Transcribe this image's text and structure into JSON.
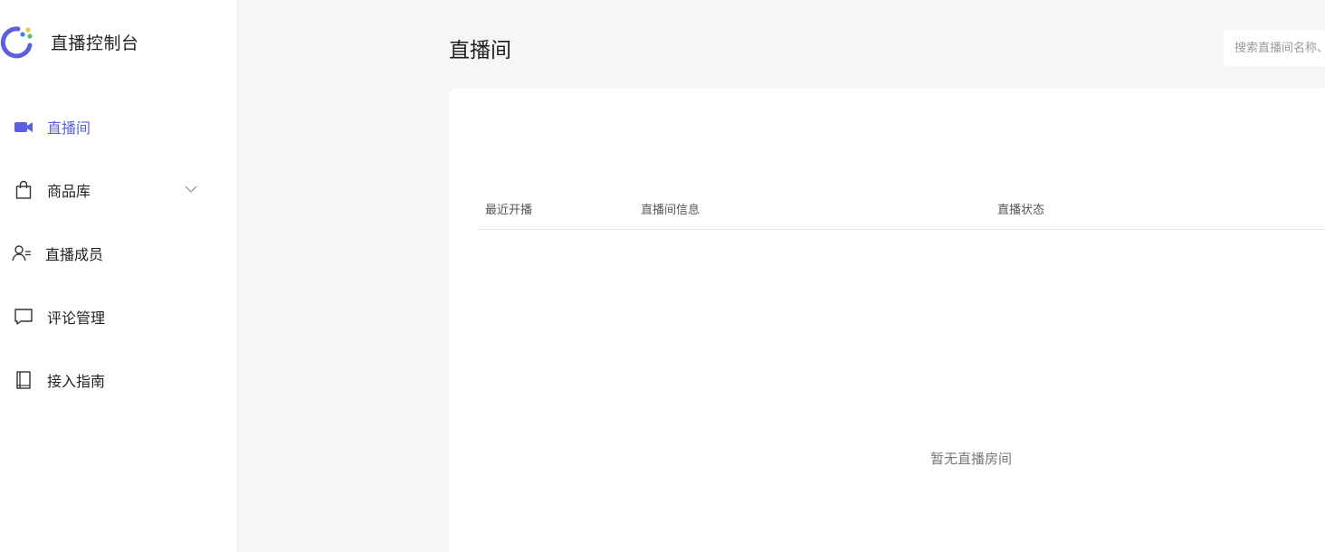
{
  "brand": {
    "title": "直播控制台",
    "logo_icon": "logo-ring-icon",
    "colors": {
      "ring": "#5b5fe0",
      "dot_blue": "#3b82f6",
      "dot_yellow": "#f6c431",
      "dot_green": "#5bbd64"
    }
  },
  "sidebar": {
    "items": [
      {
        "label": "直播间",
        "icon": "video-camera-icon",
        "active": true
      },
      {
        "label": "商品库",
        "icon": "shopping-bag-icon",
        "active": false,
        "expandable": true
      },
      {
        "label": "直播成员",
        "icon": "user-list-icon",
        "active": false
      },
      {
        "label": "评论管理",
        "icon": "comment-icon",
        "active": false
      },
      {
        "label": "接入指南",
        "icon": "book-icon",
        "active": false
      }
    ]
  },
  "header": {
    "title": "直播间",
    "search": {
      "placeholder": "搜索直播间名称、",
      "value": ""
    }
  },
  "table": {
    "columns": [
      "最近开播",
      "直播间信息",
      "直播状态"
    ],
    "rows": [],
    "empty_text": "暂无直播房间"
  },
  "theme": {
    "accent": "#5b5fe0",
    "background": "#f5f6f8",
    "surface": "#ffffff"
  }
}
